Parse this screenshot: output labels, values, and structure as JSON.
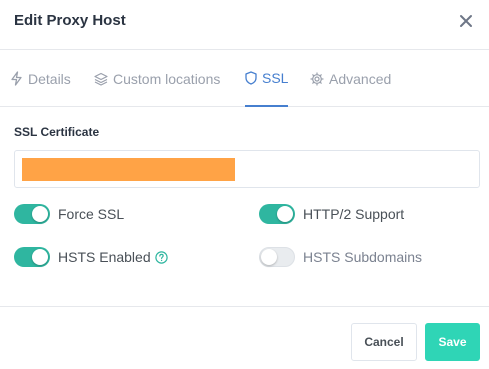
{
  "modal": {
    "title": "Edit Proxy Host"
  },
  "tabs": [
    {
      "label": "Details",
      "icon": "lightning-icon",
      "active": false
    },
    {
      "label": "Custom locations",
      "icon": "layers-icon",
      "active": false
    },
    {
      "label": "SSL",
      "icon": "shield-icon",
      "active": true
    },
    {
      "label": "Advanced",
      "icon": "gear-icon",
      "active": false
    }
  ],
  "ssl": {
    "certificate_label": "SSL Certificate",
    "certificate_value_redacted_color": "#ffa346",
    "toggles": {
      "force_ssl": {
        "label": "Force SSL",
        "enabled": true
      },
      "http2": {
        "label": "HTTP/2 Support",
        "enabled": true
      },
      "hsts": {
        "label": "HSTS Enabled",
        "enabled": true
      },
      "hsts_subdomains": {
        "label": "HSTS Subdomains",
        "enabled": false
      }
    }
  },
  "footer": {
    "cancel_label": "Cancel",
    "save_label": "Save"
  },
  "colors": {
    "accent": "#467fcf",
    "toggle_on": "#2fb6a0",
    "save": "#2fd5b6"
  }
}
